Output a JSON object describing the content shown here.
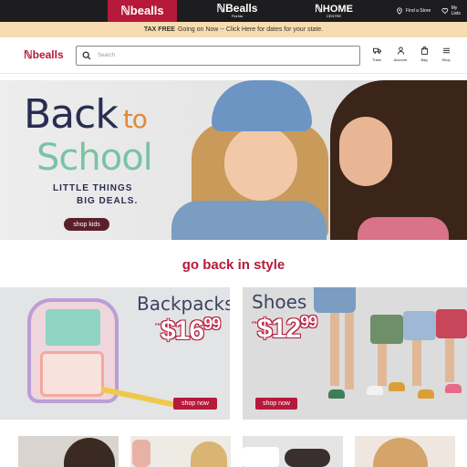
{
  "topbar": {
    "brands": [
      {
        "label": "ℕbealls",
        "sub": ""
      },
      {
        "label": "ℕBealls",
        "sub": "Florida"
      },
      {
        "label": "ℕHOME",
        "sub": "CENTRE"
      }
    ],
    "find_store": "Find a Store",
    "my_lists": "My Lists"
  },
  "tax_banner": {
    "bold": "TAX FREE",
    "text": "Going on Now -- Click Here for dates for your state."
  },
  "header": {
    "logo": "ℕbealls",
    "search_placeholder": "Search",
    "icons": [
      {
        "label": "Track",
        "icon": "truck-icon"
      },
      {
        "label": "Account",
        "icon": "person-icon"
      },
      {
        "label": "Bag",
        "icon": "bag-icon"
      },
      {
        "label": "Shop",
        "icon": "menu-icon"
      }
    ]
  },
  "hero": {
    "title_back": "Back",
    "title_to": "to",
    "title_school": "School",
    "subtitle1": "LITTLE THINGS",
    "subtitle2": "BIG DEALS.",
    "cta": "shop kids"
  },
  "section_title": "go back in style",
  "promos": [
    {
      "title": "Backpacks",
      "from": "FROM",
      "price_dollars": "$16",
      "price_cents": "99",
      "cta": "shop now"
    },
    {
      "title": "Shoes",
      "from": "FROM",
      "price_dollars": "$12",
      "price_cents": "99",
      "cta": "shop now"
    }
  ],
  "colors": {
    "brand_red": "#b51a3a",
    "top_bar": "#1d1d1f",
    "tax_banner": "#f6dcb0",
    "hero_button": "#5a1f2d"
  }
}
